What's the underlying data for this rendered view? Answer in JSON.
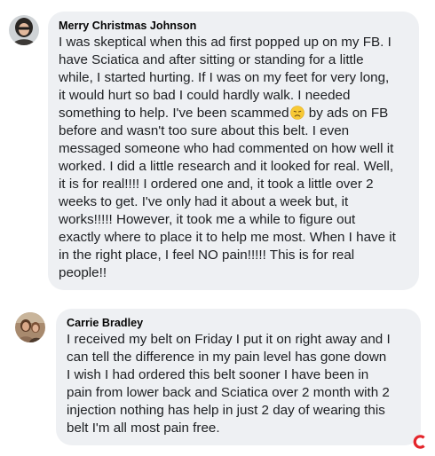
{
  "comments": [
    {
      "author": "Merry Christmas Johnson",
      "text_before_emoji": "I was skeptical when this ad first popped up on my FB. I\nhave Sciatica and after sitting or standing for a little\nwhile, I started hurting. If I was on my feet for very long,\nit would hurt so bad I could hardly walk. I needed\nsomething to help. I've been scammed",
      "emoji_icon": "disappointed-face-emoji",
      "text_after_emoji": " by ads on FB\nbefore and wasn't too sure about this belt. I even\nmessaged someone who had commented on how well it\nworked. I did a little research and it looked for real. Well,\nit is for real!!!! I ordered one and, it took a little over 2\nweeks to get. I've only had it about a week but, it\nworks!!!!! However, it took me a while to figure out\nexactly where to place it to help me most. When I have it\nin the right place, I feel NO pain!!!!! This is for real\npeople!!"
    },
    {
      "author": "Carrie Bradley",
      "text": "I received my belt on Friday I put it on right away and I\ncan tell the difference in my pain level has gone down\nI wish I had ordered this belt sooner I have been in\npain from lower back and Sciatica over 2 month with 2\ninjection nothing has help in just 2 day of wearing this\nbelt I'm all most pain free."
    }
  ],
  "colors": {
    "bubble_background": "#eef0f3",
    "text": "#1c1e21",
    "brand_mark": "#e4252b"
  },
  "brand_icon": "red-c-logo-icon"
}
